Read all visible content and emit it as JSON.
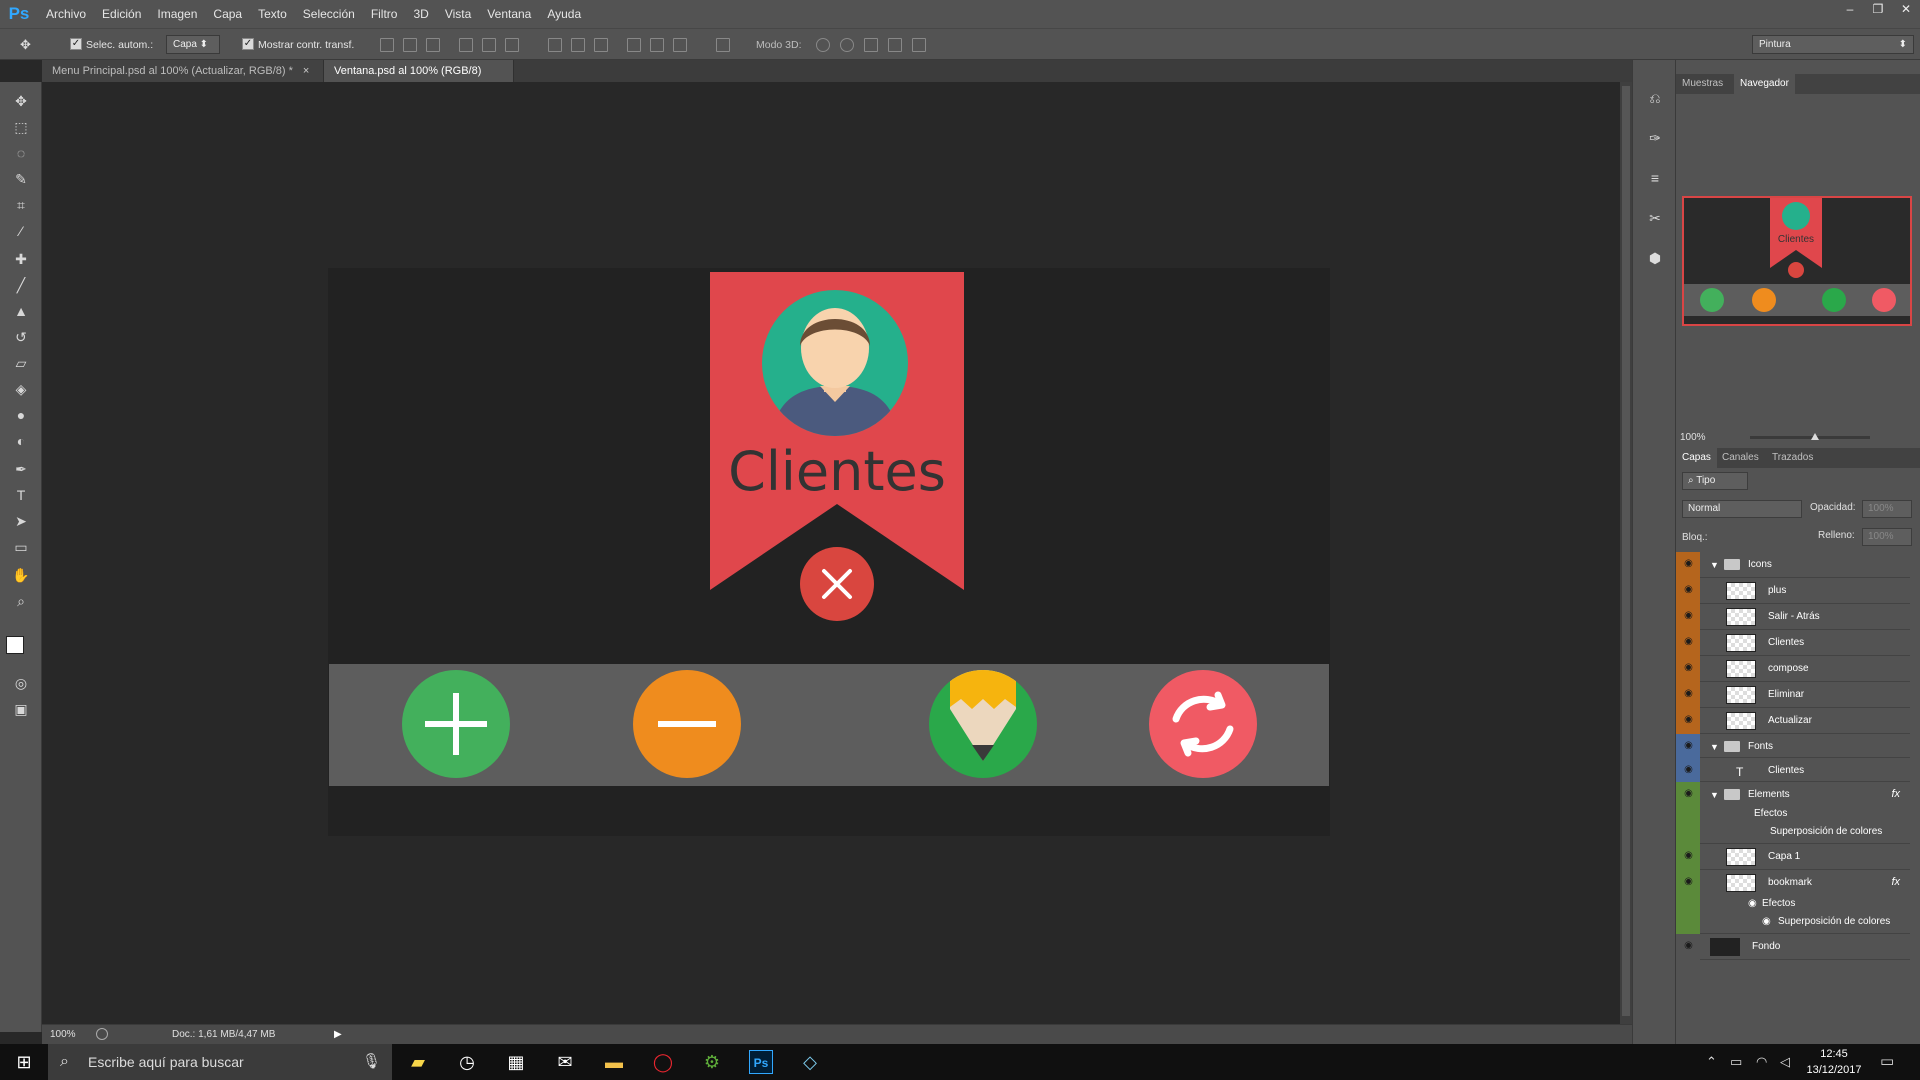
{
  "app": {
    "logo": "Ps"
  },
  "menu": [
    "Archivo",
    "Edición",
    "Imagen",
    "Capa",
    "Texto",
    "Selección",
    "Filtro",
    "3D",
    "Vista",
    "Ventana",
    "Ayuda"
  ],
  "options": {
    "auto_select_label": "Selec. autom.:",
    "auto_select_value": "Capa",
    "transform_label": "Mostrar contr. transf.",
    "mode3d_label": "Modo 3D:",
    "workspace": "Pintura"
  },
  "tabs": [
    {
      "label": "Menu Principal.psd al 100% (Actualizar, RGB/8) *",
      "close": "×"
    },
    {
      "label": "Ventana.psd al 100% (RGB/8) *",
      "close": "×"
    }
  ],
  "canvas": {
    "title_text": "Clientes"
  },
  "status": {
    "zoom": "100%",
    "doc": "Doc.: 1,61 MB/4,47 MB"
  },
  "panels": {
    "top_tabs": [
      "Muestras",
      "Navegador"
    ],
    "nav_zoom": "100%",
    "nav_thumb_text": "Clientes",
    "layer_tabs": [
      "Capas",
      "Canales",
      "Trazados"
    ],
    "filter": "Tipo",
    "blend": "Normal",
    "opacity_label": "Opacidad:",
    "opacity_value": "100%",
    "lock_label": "Bloq.:",
    "fill_label": "Relleno:",
    "fill_value": "100%"
  },
  "layers": [
    {
      "name": "Icons",
      "type": "group",
      "color": "#b5651d"
    },
    {
      "name": "plus",
      "type": "smart",
      "color": "#b5651d"
    },
    {
      "name": "Salir - Atrás",
      "type": "smart",
      "color": "#b5651d"
    },
    {
      "name": "Clientes",
      "type": "smart",
      "color": "#b5651d"
    },
    {
      "name": "compose",
      "type": "smart",
      "color": "#b5651d"
    },
    {
      "name": "Eliminar",
      "type": "smart",
      "color": "#b5651d"
    },
    {
      "name": "Actualizar",
      "type": "smart",
      "color": "#b5651d"
    },
    {
      "name": "Fonts",
      "type": "group",
      "color": "#4a6a9c"
    },
    {
      "name": "Clientes",
      "type": "text",
      "color": "#4a6a9c"
    },
    {
      "name": "Elements",
      "type": "group",
      "color": "#5b8a3a",
      "fx": "fx"
    },
    {
      "name": "Capa 1",
      "type": "raster",
      "color": "#5b8a3a"
    },
    {
      "name": "bookmark",
      "type": "raster",
      "color": "#5b8a3a",
      "fx": "fx"
    },
    {
      "name": "Fondo",
      "type": "bg",
      "color": "#535353"
    }
  ],
  "effects": {
    "elements_effects": "Efectos",
    "elements_overlay": "Superposición de colores",
    "bookmark_effects": "Efectos",
    "bookmark_overlay": "Superposición de colores"
  },
  "taskbar": {
    "search_placeholder": "Escribe aquí para buscar",
    "time": "12:45",
    "date": "13/12/2017"
  },
  "colors": {
    "bookmark": "#e0474c",
    "plus": "#43b05c",
    "minus": "#ef8c1e",
    "refresh": "#f05a64",
    "compose": "#2aa84a",
    "avatar_bg": "#25b08c"
  }
}
